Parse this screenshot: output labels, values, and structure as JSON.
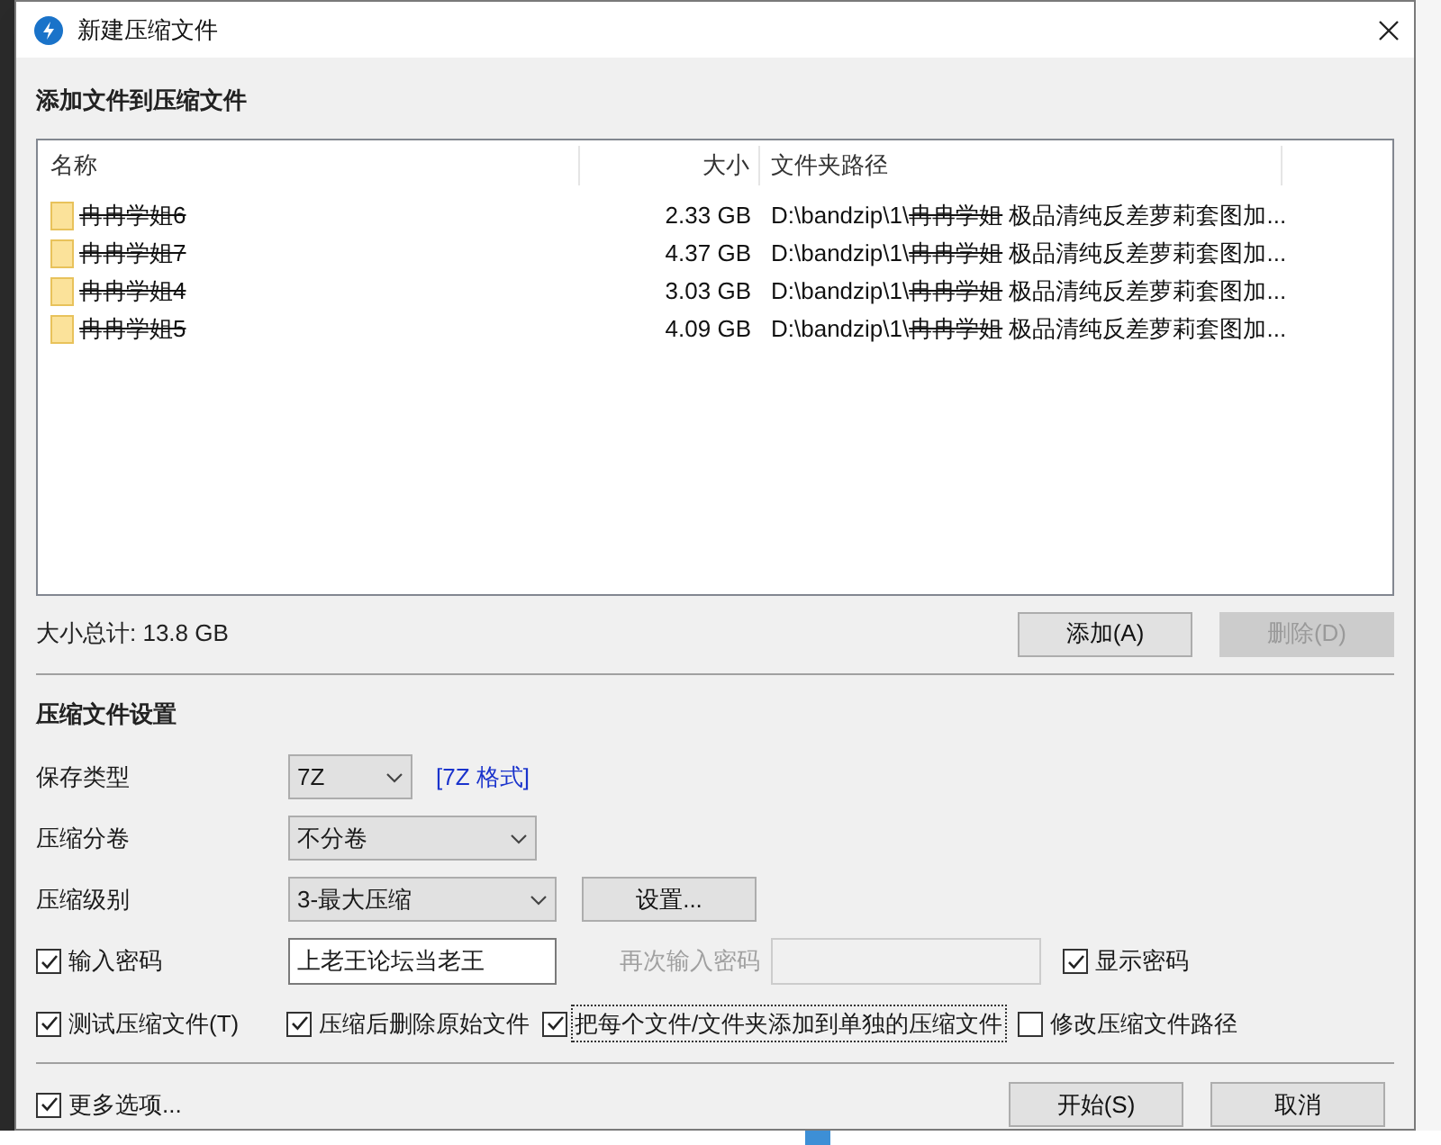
{
  "window": {
    "title": "新建压缩文件"
  },
  "add_section": {
    "title": "添加文件到压缩文件"
  },
  "file_list": {
    "columns": [
      "名称",
      "大小",
      "文件夹路径"
    ],
    "rows": [
      {
        "name": "冉冉学姐6",
        "redacted": true,
        "size": "2.33 GB",
        "path": [
          {
            "text": "D:\\bandzip\\1\\",
            "redacted": false
          },
          {
            "text": "冉冉学姐",
            "redacted": true
          },
          {
            "text": " 极品清纯反差萝莉套图加...",
            "redacted": false
          }
        ]
      },
      {
        "name": "冉冉学姐7",
        "redacted": true,
        "size": "4.37 GB",
        "path": [
          {
            "text": "D:\\bandzip\\1\\",
            "redacted": false
          },
          {
            "text": "冉冉学姐",
            "redacted": true
          },
          {
            "text": " 极品清纯反差萝莉套图加...",
            "redacted": false
          }
        ]
      },
      {
        "name": "冉冉学姐4",
        "redacted": true,
        "size": "3.03 GB",
        "path": [
          {
            "text": "D:\\bandzip\\1\\",
            "redacted": false
          },
          {
            "text": "冉冉学姐",
            "redacted": true
          },
          {
            "text": " 极品清纯反差萝莉套图加...",
            "redacted": false
          }
        ]
      },
      {
        "name": "冉冉学姐5",
        "redacted": true,
        "size": "4.09 GB",
        "path": [
          {
            "text": "D:\\bandzip\\1\\",
            "redacted": false
          },
          {
            "text": "冉冉学姐",
            "redacted": true
          },
          {
            "text": " 极品清纯反差萝莉套图加...",
            "redacted": false
          }
        ]
      }
    ]
  },
  "total": "大小总计: 13.8 GB",
  "list_buttons": [
    {
      "label": "添加(A)",
      "disabled": false
    },
    {
      "label": "删除(D)",
      "disabled": true
    }
  ],
  "settings": {
    "title": "压缩文件设置",
    "save_type": {
      "label": "保存类型",
      "value": "7Z",
      "link": "[7Z 格式]"
    },
    "split": {
      "label": "压缩分卷",
      "value": "不分卷"
    },
    "level": {
      "label": "压缩级别",
      "value": "3-最大压缩",
      "button": "设置..."
    },
    "password": {
      "label": "输入密码",
      "checked": true,
      "value": "上老王论坛当老王",
      "confirm_label": "再次输入密码",
      "confirm_disabled": true,
      "show_label": "显示密码",
      "show_checked": true
    },
    "options": [
      {
        "label": "测试压缩文件(T)",
        "checked": true,
        "focused": false
      },
      {
        "label": "压缩后删除原始文件",
        "checked": true,
        "focused": false
      },
      {
        "label": "把每个文件/文件夹添加到单独的压缩文件",
        "checked": true,
        "focused": true
      },
      {
        "label": "修改压缩文件路径",
        "checked": false,
        "focused": false
      }
    ]
  },
  "footer": {
    "more_label": "更多选项...",
    "more_checked": true,
    "buttons": [
      "开始(S)",
      "取消"
    ]
  }
}
